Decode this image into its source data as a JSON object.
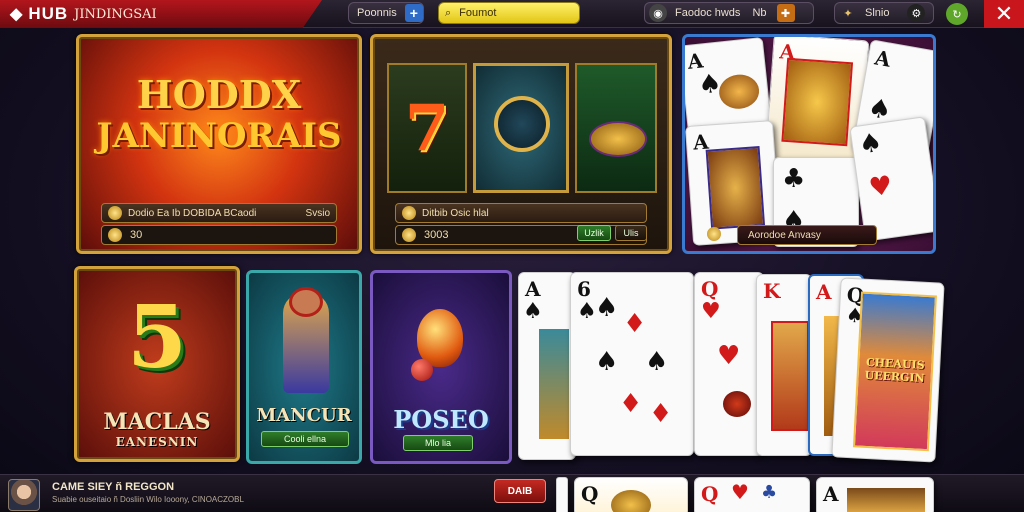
{
  "header": {
    "logo_icon": "diamond-logo-icon",
    "brand": "HUB",
    "subtitle": "JINDINGSAI",
    "pill1": "Poonnis",
    "plus": "+",
    "search": "Foumot",
    "pill3": "Faodoc hwds",
    "pill3_badge": "Nb",
    "pill4": "Slnio",
    "close": "✕"
  },
  "tiles": {
    "hoodx": {
      "title_line1": "HODDX",
      "title_line2": "JANINORAIS",
      "info": "Dodio Ea Ib DOBIDA BCaodi",
      "info_right": "Svsio",
      "value": "30"
    },
    "slot2": {
      "seven": "7",
      "info": "Ditbib Osic hlal",
      "value": "3003",
      "btn_left": "Uzlik",
      "btn_right": "Ulis"
    },
    "cards3": {
      "info": "Aorodoe Anvasy"
    },
    "maclas": {
      "num": "5",
      "title": "MACLAS",
      "subtitle": "EANESNIN"
    },
    "mancur": {
      "title": "MANCUR",
      "btn": "Cooli ellna"
    },
    "poseo": {
      "title": "POSEO",
      "btn": "Mlo lia"
    },
    "cardrow": {
      "card1": "A",
      "card2": "6",
      "card3": "Q",
      "card4": "K",
      "card5": "A",
      "card6": "Q",
      "poster": "CHEAUIS UEERGIN"
    }
  },
  "bottom": {
    "title": "CAME SIEY ñ REGGON",
    "desc": "Suabie ouseitaio ñ Dosliin Wilo Iooony, CINOACZOBL",
    "button": "DAIB",
    "card_a": "Q",
    "card_b": "Q",
    "card_c": "A"
  },
  "colors": {
    "accent_red": "#c8161c",
    "gold": "#d4a23a",
    "search_yellow": "#f2dc2a"
  }
}
